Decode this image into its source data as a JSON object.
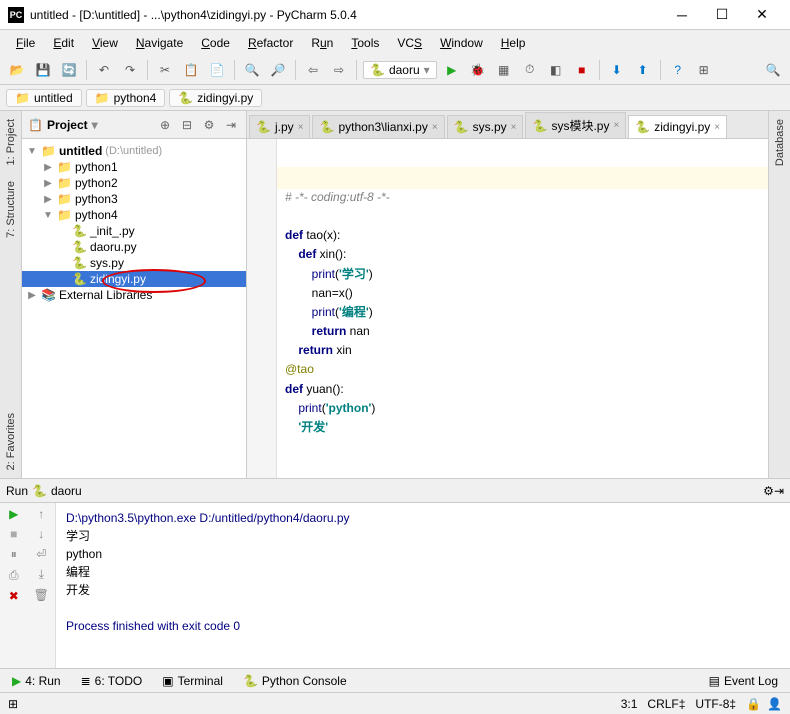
{
  "title": "untitled - [D:\\untitled] - ...\\python4\\zidingyi.py - PyCharm 5.0.4",
  "menu": [
    "File",
    "Edit",
    "View",
    "Navigate",
    "Code",
    "Refactor",
    "Run",
    "Tools",
    "VCS",
    "Window",
    "Help"
  ],
  "run_config": "daoru",
  "breadcrumbs": [
    "untitled",
    "python4",
    "zidingyi.py"
  ],
  "left_tabs": [
    "1: Project",
    "7: Structure",
    "2: Favorites"
  ],
  "right_tabs": [
    "Database"
  ],
  "project_panel": {
    "title": "Project"
  },
  "tree": {
    "root": {
      "name": "untitled",
      "hint": "(D:\\untitled)"
    },
    "python1": "python1",
    "python2": "python2",
    "python3": "python3",
    "python4": "python4",
    "files": {
      "init": "_init_.py",
      "daoru": "daoru.py",
      "sys": "sys.py",
      "zidingyi": "zidingyi.py"
    },
    "ext": "External Libraries"
  },
  "tabs": [
    {
      "label": "j.py"
    },
    {
      "label": "python3\\lianxi.py"
    },
    {
      "label": "sys.py"
    },
    {
      "label": "sys模块.py"
    },
    {
      "label": "zidingyi.py"
    }
  ],
  "code": {
    "l1": "# -*- coding:utf-8 -*-",
    "l3_def": "def",
    "l3_fn": " tao",
    "l3_rest": "(x):",
    "l4_def": "def",
    "l4_fn": " xin",
    "l4_rest": "():",
    "l5_print": "print",
    "l5_s": "'学习'",
    "l6": "nan=x()",
    "l7_print": "print",
    "l7_s": "'编程'",
    "l8_ret": "return",
    "l8_rest": " nan",
    "l9_ret": "return",
    "l9_rest": " xin",
    "l10": "@tao",
    "l11_def": "def",
    "l11_fn": " yuan",
    "l11_rest": "():",
    "l12_print": "print",
    "l12_s": "'python'",
    "l13a": "    ",
    "l13b": "'开发'"
  },
  "run": {
    "title": "Run",
    "config": "daoru",
    "cmd": "D:\\python3.5\\python.exe D:/untitled/python4/daoru.py",
    "out1": "学习",
    "out2": "python",
    "out3": "编程",
    "out4": "开发",
    "exit": "Process finished with exit code 0"
  },
  "statusbar": {
    "run": "4: Run",
    "todo": "6: TODO",
    "terminal": "Terminal",
    "console": "Python Console",
    "eventlog": "Event Log"
  },
  "footer": {
    "pos": "3:1",
    "crlf": "CRLF‡",
    "enc": "UTF-8‡",
    "lock": "🔒"
  }
}
